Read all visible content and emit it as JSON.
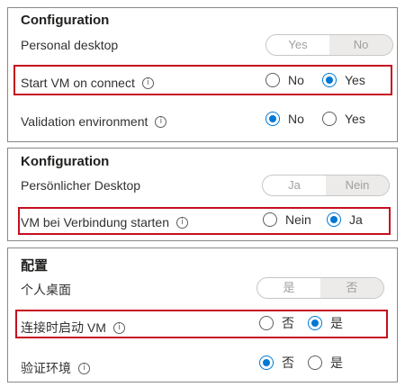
{
  "panels": {
    "en": {
      "title": "Configuration",
      "personal_desktop": {
        "label": "Personal desktop",
        "options": [
          "Yes",
          "No"
        ],
        "selected": "No"
      },
      "start_vm": {
        "label": "Start VM on connect",
        "options": [
          "No",
          "Yes"
        ],
        "selected": "Yes"
      },
      "validation": {
        "label": "Validation environment",
        "options": [
          "No",
          "Yes"
        ],
        "selected": "No"
      }
    },
    "de": {
      "title": "Konfiguration",
      "personal_desktop": {
        "label": "Persönlicher Desktop",
        "options": [
          "Ja",
          "Nein"
        ],
        "selected": "Nein"
      },
      "start_vm": {
        "label": "VM bei Verbindung starten",
        "options": [
          "Nein",
          "Ja"
        ],
        "selected": "Ja"
      }
    },
    "zh": {
      "title": "配置",
      "personal_desktop": {
        "label": "个人桌面",
        "options": [
          "是",
          "否"
        ],
        "selected": "否"
      },
      "start_vm": {
        "label": "连接时启动 VM",
        "options": [
          "否",
          "是"
        ],
        "selected": "是"
      },
      "validation": {
        "label": "验证环境",
        "options": [
          "否",
          "是"
        ],
        "selected": "否"
      }
    }
  },
  "icons": {
    "info": "info-icon"
  },
  "colors": {
    "accent": "#0078d4",
    "highlight": "#c50f1f",
    "border": "#8a8886"
  }
}
